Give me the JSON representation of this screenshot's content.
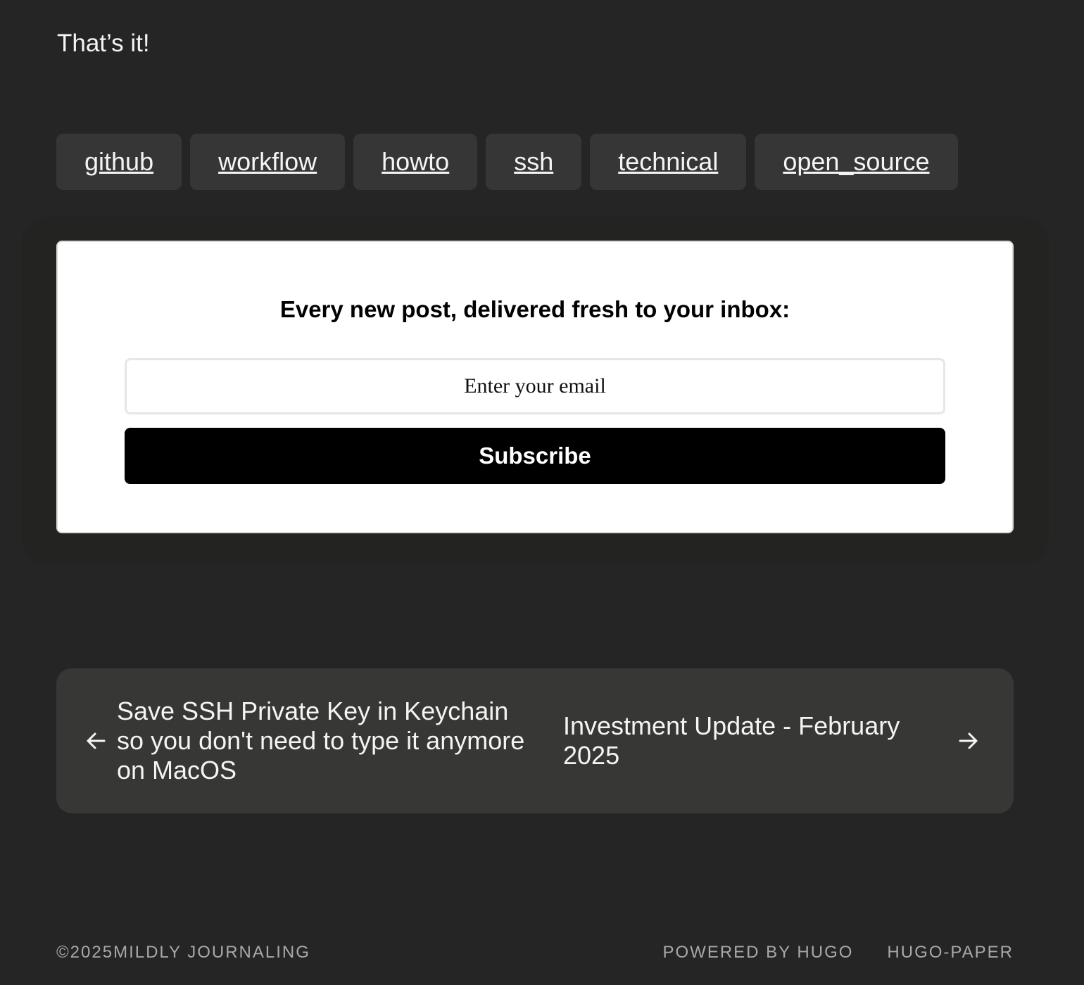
{
  "content": {
    "closing_text": "That’s it!"
  },
  "tags": [
    {
      "label": "github"
    },
    {
      "label": "workflow"
    },
    {
      "label": "howto"
    },
    {
      "label": "ssh"
    },
    {
      "label": "technical"
    },
    {
      "label": "open_source"
    }
  ],
  "subscribe": {
    "heading": "Every new post, delivered fresh to your inbox:",
    "email_placeholder": "Enter your email",
    "button_label": "Subscribe"
  },
  "post_nav": {
    "prev": {
      "title": "Save SSH Private Key in Keychain so you don't need to type it anymore on MacOS",
      "icon": "arrow-left-icon"
    },
    "next": {
      "title": "Investment Update - February 2025",
      "icon": "arrow-right-icon"
    }
  },
  "footer": {
    "copyright": "©2025MILDLY JOURNALING",
    "powered_by": "POWERED BY HUGO",
    "theme": "HUGO-PAPER"
  },
  "colors": {
    "background": "#252525",
    "tag_bg": "#363636",
    "nav_bg": "#373735",
    "button_bg": "#000000",
    "card_bg": "#ffffff",
    "footer_text": "#a8a8a8"
  }
}
